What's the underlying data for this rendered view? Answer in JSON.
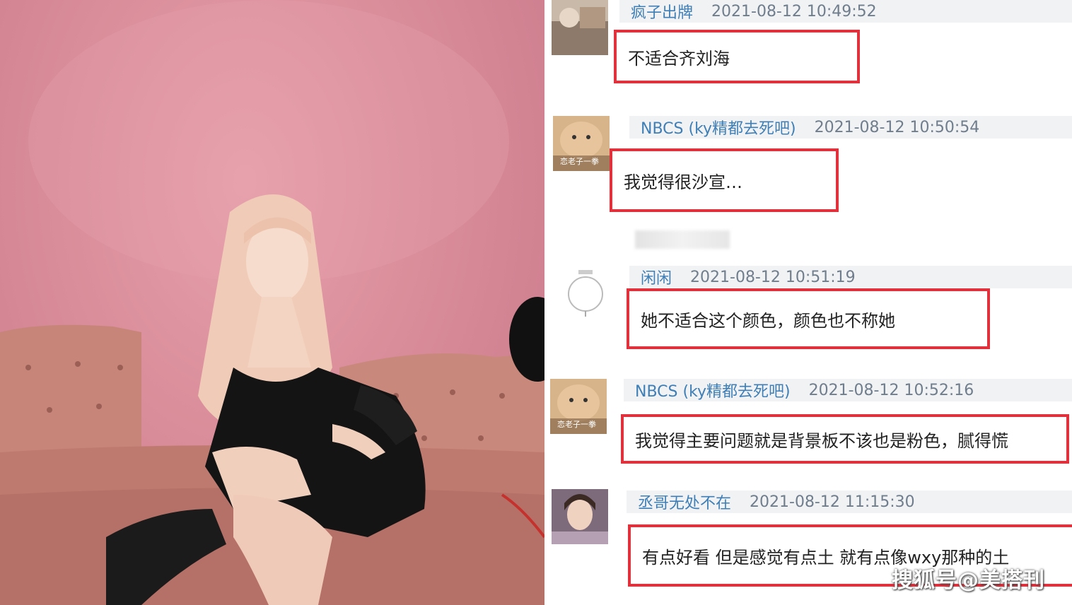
{
  "comments": [
    {
      "username": "疯子出牌",
      "timestamp": "2021-08-12 10:49:52",
      "text": "不适合齐刘海",
      "avatar": "car-photo-avatar"
    },
    {
      "username": "NBCS (ky精都去死吧)",
      "timestamp": "2021-08-12 10:50:54",
      "text": "我觉得很沙宣…",
      "avatar": "cat-meme-avatar"
    },
    {
      "username": "闲闲",
      "timestamp": "2021-08-12 10:51:19",
      "text": "她不适合这个颜色，颜色也不称她",
      "avatar": "sketch-circle-avatar"
    },
    {
      "username": "NBCS (ky精都去死吧)",
      "timestamp": "2021-08-12 10:52:16",
      "text": "我觉得主要问题就是背景板不该也是粉色，腻得慌",
      "avatar": "cat-meme-avatar"
    },
    {
      "username": "丞哥无处不在",
      "timestamp": "2021-08-12 11:15:30",
      "text": "有点好看 但是感觉有点土 就有点像wxy那种的土",
      "avatar": "girl-photo-avatar"
    }
  ],
  "avatar_caption": "恋老子一拳",
  "watermark": "搜狐号@美搭刊",
  "colors": {
    "highlight_border": "#e0313d",
    "username": "#3f7fb6",
    "meta_bar": "#f1f2f4",
    "backdrop": "#d98c99"
  }
}
